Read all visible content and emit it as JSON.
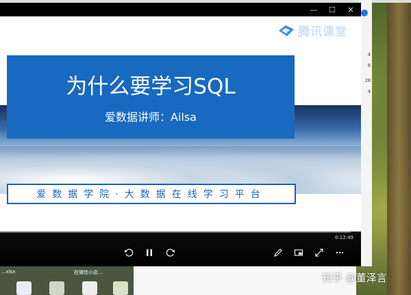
{
  "player": {
    "brand": "腾讯课堂",
    "time": "0:12:49",
    "controls": {
      "rewind_label": "10",
      "forward_label": "30"
    }
  },
  "slide": {
    "title": "为什么要学习SQL",
    "subtitle": "爱数据讲师：Ailsa",
    "platform": "爱数据学院·大数据在线学习平台"
  },
  "side_window": {
    "numbers": [
      "4",
      "8",
      "28",
      "4"
    ]
  },
  "taskbar": {
    "items": [
      "...xlsx",
      "在微信小店..."
    ]
  },
  "watermark": "知乎 @董泽言",
  "icons": [
    "minimize-icon",
    "maximize-icon",
    "close-icon",
    "rewind-10-icon",
    "pause-icon",
    "forward-30-icon",
    "edit-icon",
    "picture-in-picture-icon",
    "fullscreen-icon",
    "more-icon"
  ]
}
